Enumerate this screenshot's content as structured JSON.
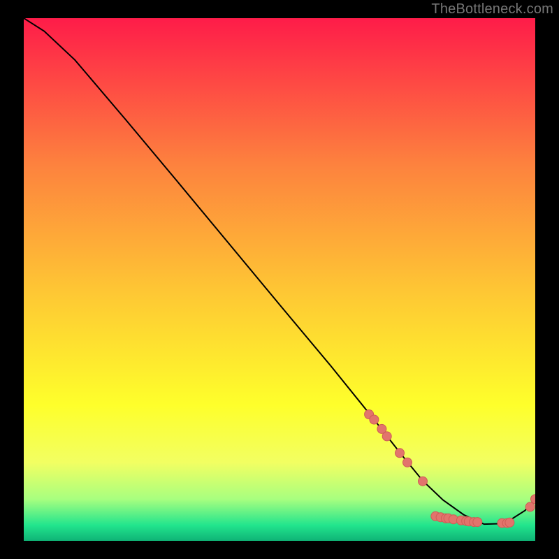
{
  "watermark": "TheBottleneck.com",
  "colors": {
    "marker_fill": "#e2746c",
    "marker_stroke": "#cf5c56",
    "curve": "#000000",
    "bg_top": "#fe1c49",
    "bg_upper_mid": "#fd823e",
    "bg_mid": "#fec634",
    "bg_yellow": "#feff2b",
    "bg_lightyellow": "#f2ff62",
    "bg_lime": "#a8ff7f",
    "bg_green": "#22e58d",
    "bg_dkgreen": "#0fb376"
  },
  "chart_data": {
    "type": "line",
    "title": "",
    "xlabel": "",
    "ylabel": "",
    "xlim": [
      0,
      100
    ],
    "ylim": [
      0,
      100
    ],
    "series": [
      {
        "name": "bottleneck-curve",
        "x": [
          0,
          4,
          10,
          20,
          30,
          40,
          50,
          60,
          68,
          74,
          78,
          82,
          86,
          90,
          94,
          98,
          100
        ],
        "y": [
          100,
          97.5,
          92,
          80.5,
          68.8,
          57,
          45.2,
          33.5,
          23.8,
          16.3,
          11.5,
          7.8,
          5,
          3.2,
          3.3,
          5.8,
          8
        ]
      }
    ],
    "markers": {
      "name": "highlighted-points",
      "points": [
        {
          "x": 67.5,
          "y": 24.2
        },
        {
          "x": 68.5,
          "y": 23.2
        },
        {
          "x": 70.0,
          "y": 21.4
        },
        {
          "x": 71.0,
          "y": 20.0
        },
        {
          "x": 73.5,
          "y": 16.8
        },
        {
          "x": 75.0,
          "y": 15.0
        },
        {
          "x": 78.0,
          "y": 11.4
        },
        {
          "x": 80.5,
          "y": 4.7
        },
        {
          "x": 81.5,
          "y": 4.5
        },
        {
          "x": 82.5,
          "y": 4.3
        },
        {
          "x": 83.0,
          "y": 4.3
        },
        {
          "x": 84.0,
          "y": 4.1
        },
        {
          "x": 85.5,
          "y": 3.9
        },
        {
          "x": 86.5,
          "y": 3.8
        },
        {
          "x": 87.0,
          "y": 3.7
        },
        {
          "x": 88.0,
          "y": 3.6
        },
        {
          "x": 88.7,
          "y": 3.6
        },
        {
          "x": 93.5,
          "y": 3.4
        },
        {
          "x": 94.5,
          "y": 3.4
        },
        {
          "x": 95.0,
          "y": 3.5
        },
        {
          "x": 99.0,
          "y": 6.5
        },
        {
          "x": 100.0,
          "y": 8.0
        }
      ]
    }
  }
}
